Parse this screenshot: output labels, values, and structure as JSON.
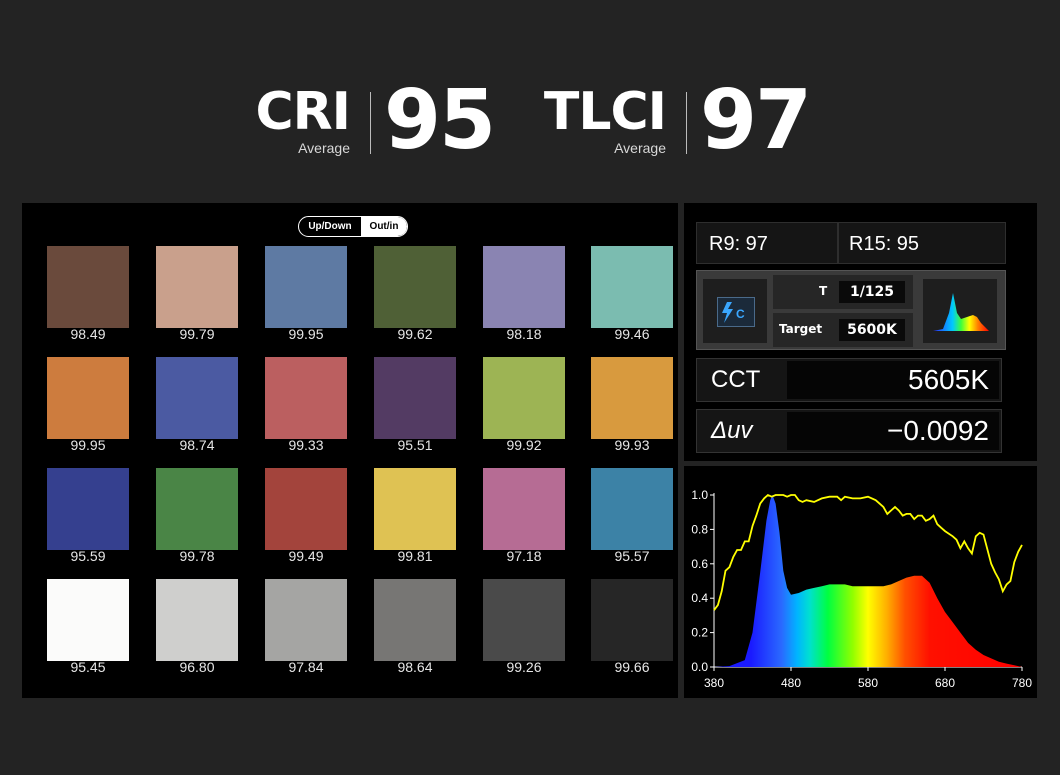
{
  "header": {
    "cri": {
      "name": "CRI",
      "sub": "Average",
      "value": "95"
    },
    "tlci": {
      "name": "TLCI",
      "sub": "Average",
      "value": "97"
    }
  },
  "color_checker": {
    "toggle": {
      "left": "Up/Down",
      "right": "Out/in"
    },
    "swatches": [
      {
        "color": "#6a4a3c",
        "value": "98.49"
      },
      {
        "color": "#c9a08c",
        "value": "99.79"
      },
      {
        "color": "#5e7aa3",
        "value": "99.95"
      },
      {
        "color": "#4f6036",
        "value": "99.62"
      },
      {
        "color": "#8a84b2",
        "value": "98.18"
      },
      {
        "color": "#7bbcb0",
        "value": "99.46"
      },
      {
        "color": "#cd7c3e",
        "value": "99.95"
      },
      {
        "color": "#4b5aa2",
        "value": "98.74"
      },
      {
        "color": "#bb5f60",
        "value": "99.33"
      },
      {
        "color": "#533b63",
        "value": "95.51"
      },
      {
        "color": "#9db454",
        "value": "99.92"
      },
      {
        "color": "#d89a3e",
        "value": "99.93"
      },
      {
        "color": "#35408f",
        "value": "95.59"
      },
      {
        "color": "#4a8546",
        "value": "99.78"
      },
      {
        "color": "#a3443c",
        "value": "99.49"
      },
      {
        "color": "#dfc253",
        "value": "99.81"
      },
      {
        "color": "#b66c94",
        "value": "97.18"
      },
      {
        "color": "#3c82a6",
        "value": "95.57"
      },
      {
        "color": "#fbfbfa",
        "value": "95.45"
      },
      {
        "color": "#cfcfcd",
        "value": "96.80"
      },
      {
        "color": "#a5a5a3",
        "value": "97.84"
      },
      {
        "color": "#777674",
        "value": "98.64"
      },
      {
        "color": "#4a4a4a",
        "value": "99.26"
      },
      {
        "color": "#262626",
        "value": "99.66"
      }
    ]
  },
  "meter": {
    "r9": "R9: 97",
    "r15": "R15: 95",
    "flash_icon": "flash-c-icon",
    "t_label": "T",
    "t_value": "1/125",
    "target_label": "Target",
    "target_value": "5600K",
    "spectrum_icon": "spectrum-thumbnail-icon",
    "cct_label": "CCT",
    "cct_value": "5605K",
    "duv_label": "Δuv",
    "duv_value": "−0.0092"
  },
  "chart_data": {
    "type": "area",
    "xlim": [
      380,
      780
    ],
    "ylim": [
      0,
      1.0
    ],
    "x_ticks": [
      "380",
      "480",
      "580",
      "680",
      "780"
    ],
    "y_ticks": [
      "0.0",
      "0.2",
      "0.4",
      "0.6",
      "0.8",
      "1.0"
    ],
    "series": [
      {
        "values": [
          [
            380,
            0.0
          ],
          [
            400,
            0.005
          ],
          [
            420,
            0.04
          ],
          [
            430,
            0.2
          ],
          [
            440,
            0.55
          ],
          [
            448,
            0.85
          ],
          [
            453,
            0.97
          ],
          [
            456,
            1.0
          ],
          [
            460,
            0.95
          ],
          [
            465,
            0.78
          ],
          [
            470,
            0.56
          ],
          [
            475,
            0.46
          ],
          [
            480,
            0.42
          ],
          [
            490,
            0.43
          ],
          [
            500,
            0.45
          ],
          [
            510,
            0.46
          ],
          [
            520,
            0.47
          ],
          [
            530,
            0.48
          ],
          [
            540,
            0.48
          ],
          [
            550,
            0.48
          ],
          [
            560,
            0.47
          ],
          [
            570,
            0.47
          ],
          [
            580,
            0.47
          ],
          [
            590,
            0.47
          ],
          [
            600,
            0.47
          ],
          [
            610,
            0.48
          ],
          [
            620,
            0.5
          ],
          [
            630,
            0.52
          ],
          [
            640,
            0.53
          ],
          [
            650,
            0.53
          ],
          [
            660,
            0.49
          ],
          [
            670,
            0.4
          ],
          [
            680,
            0.32
          ],
          [
            690,
            0.26
          ],
          [
            700,
            0.2
          ],
          [
            710,
            0.14
          ],
          [
            720,
            0.1
          ],
          [
            730,
            0.07
          ],
          [
            740,
            0.05
          ],
          [
            750,
            0.03
          ],
          [
            760,
            0.02
          ],
          [
            770,
            0.01
          ],
          [
            780,
            0.0
          ]
        ]
      },
      {
        "values": [
          [
            380,
            0.33
          ],
          [
            385,
            0.36
          ],
          [
            390,
            0.44
          ],
          [
            395,
            0.56
          ],
          [
            400,
            0.58
          ],
          [
            405,
            0.64
          ],
          [
            410,
            0.68
          ],
          [
            415,
            0.68
          ],
          [
            420,
            0.73
          ],
          [
            425,
            0.73
          ],
          [
            430,
            0.82
          ],
          [
            435,
            0.88
          ],
          [
            440,
            0.95
          ],
          [
            445,
            0.98
          ],
          [
            450,
            1.0
          ],
          [
            455,
            0.99
          ],
          [
            460,
            1.0
          ],
          [
            465,
            1.0
          ],
          [
            470,
            1.0
          ],
          [
            475,
            0.99
          ],
          [
            480,
            1.0
          ],
          [
            485,
            1.0
          ],
          [
            490,
            0.97
          ],
          [
            495,
            0.96
          ],
          [
            500,
            0.97
          ],
          [
            510,
            0.96
          ],
          [
            520,
            0.98
          ],
          [
            530,
            0.99
          ],
          [
            540,
            0.99
          ],
          [
            545,
            0.97
          ],
          [
            550,
            0.99
          ],
          [
            560,
            0.98
          ],
          [
            570,
            0.98
          ],
          [
            580,
            0.99
          ],
          [
            590,
            0.97
          ],
          [
            600,
            0.93
          ],
          [
            605,
            0.89
          ],
          [
            610,
            0.91
          ],
          [
            615,
            0.93
          ],
          [
            620,
            0.91
          ],
          [
            625,
            0.88
          ],
          [
            630,
            0.89
          ],
          [
            635,
            0.89
          ],
          [
            640,
            0.86
          ],
          [
            645,
            0.88
          ],
          [
            650,
            0.88
          ],
          [
            655,
            0.85
          ],
          [
            660,
            0.86
          ],
          [
            665,
            0.88
          ],
          [
            670,
            0.83
          ],
          [
            675,
            0.81
          ],
          [
            680,
            0.79
          ],
          [
            690,
            0.76
          ],
          [
            695,
            0.74
          ],
          [
            700,
            0.69
          ],
          [
            705,
            0.73
          ],
          [
            710,
            0.69
          ],
          [
            715,
            0.66
          ],
          [
            720,
            0.76
          ],
          [
            725,
            0.78
          ],
          [
            730,
            0.77
          ],
          [
            740,
            0.6
          ],
          [
            745,
            0.55
          ],
          [
            750,
            0.51
          ],
          [
            755,
            0.44
          ],
          [
            760,
            0.48
          ],
          [
            765,
            0.5
          ],
          [
            770,
            0.61
          ],
          [
            775,
            0.67
          ],
          [
            780,
            0.71
          ]
        ]
      }
    ]
  }
}
